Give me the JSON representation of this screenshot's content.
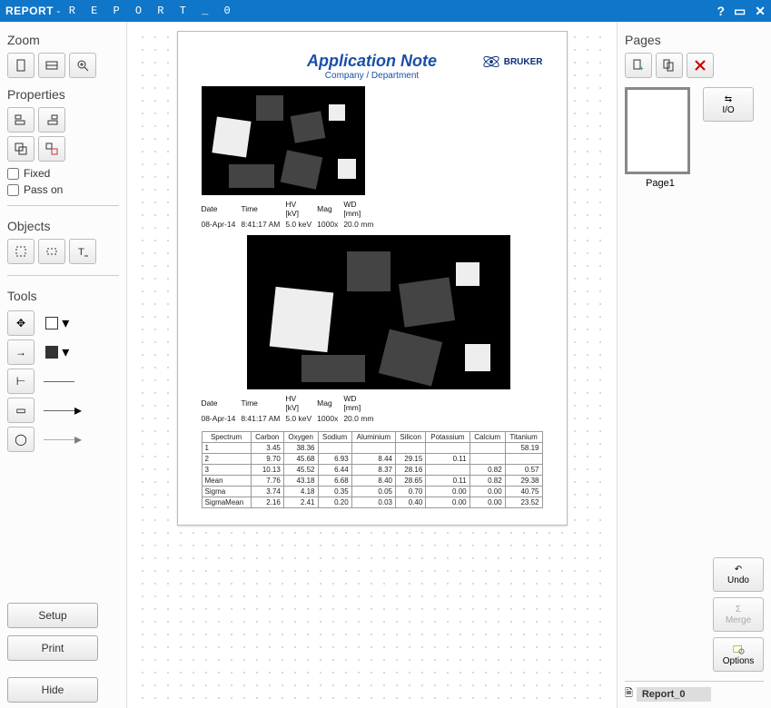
{
  "window": {
    "type": "REPORT",
    "title": "R E P O R T _ 0"
  },
  "left": {
    "zoom_label": "Zoom",
    "properties_label": "Properties",
    "fixed_label": "Fixed",
    "passon_label": "Pass on",
    "objects_label": "Objects",
    "tools_label": "Tools",
    "setup_btn": "Setup",
    "print_btn": "Print",
    "hide_btn": "Hide"
  },
  "right": {
    "pages_label": "Pages",
    "io_label": "I/O",
    "page_thumb_label": "Page1",
    "undo_label": "Undo",
    "merge_label": "Merge",
    "options_label": "Options",
    "tab_label": "Report_0"
  },
  "report": {
    "title": "Application Note",
    "subtitle": "Company / Department",
    "brand": "BRUKER",
    "meta_header": [
      "Date",
      "Time",
      "HV\n[kV]",
      "Mag",
      "WD\n[mm]"
    ],
    "meta1": [
      "08-Apr-14",
      "8:41:17 AM",
      "5.0 keV",
      "1000x",
      "20.0 mm"
    ],
    "meta2": [
      "08-Apr-14",
      "8:41:17 AM",
      "5.0 keV",
      "1000x",
      "20.0 mm"
    ],
    "table_header": [
      "Spectrum",
      "Carbon",
      "Oxygen",
      "Sodium",
      "Aluminium",
      "Silicon",
      "Potassium",
      "Calcium",
      "Titanium"
    ],
    "table_rows": [
      [
        "1",
        "3.45",
        "38.36",
        "",
        "",
        "",
        "",
        "",
        "58.19"
      ],
      [
        "2",
        "9.70",
        "45.68",
        "6.93",
        "8.44",
        "29.15",
        "0.11",
        "",
        ""
      ],
      [
        "3",
        "10.13",
        "45.52",
        "6.44",
        "8.37",
        "28.16",
        "",
        "0.82",
        "0.57"
      ],
      [
        "Mean",
        "7.76",
        "43.18",
        "6.68",
        "8.40",
        "28.65",
        "0.11",
        "0.82",
        "29.38"
      ],
      [
        "Sigma",
        "3.74",
        "4.18",
        "0.35",
        "0.05",
        "0.70",
        "0.00",
        "0.00",
        "40.75"
      ],
      [
        "SigmaMean",
        "2.16",
        "2.41",
        "0.20",
        "0.03",
        "0.40",
        "0.00",
        "0.00",
        "23.52"
      ]
    ]
  }
}
